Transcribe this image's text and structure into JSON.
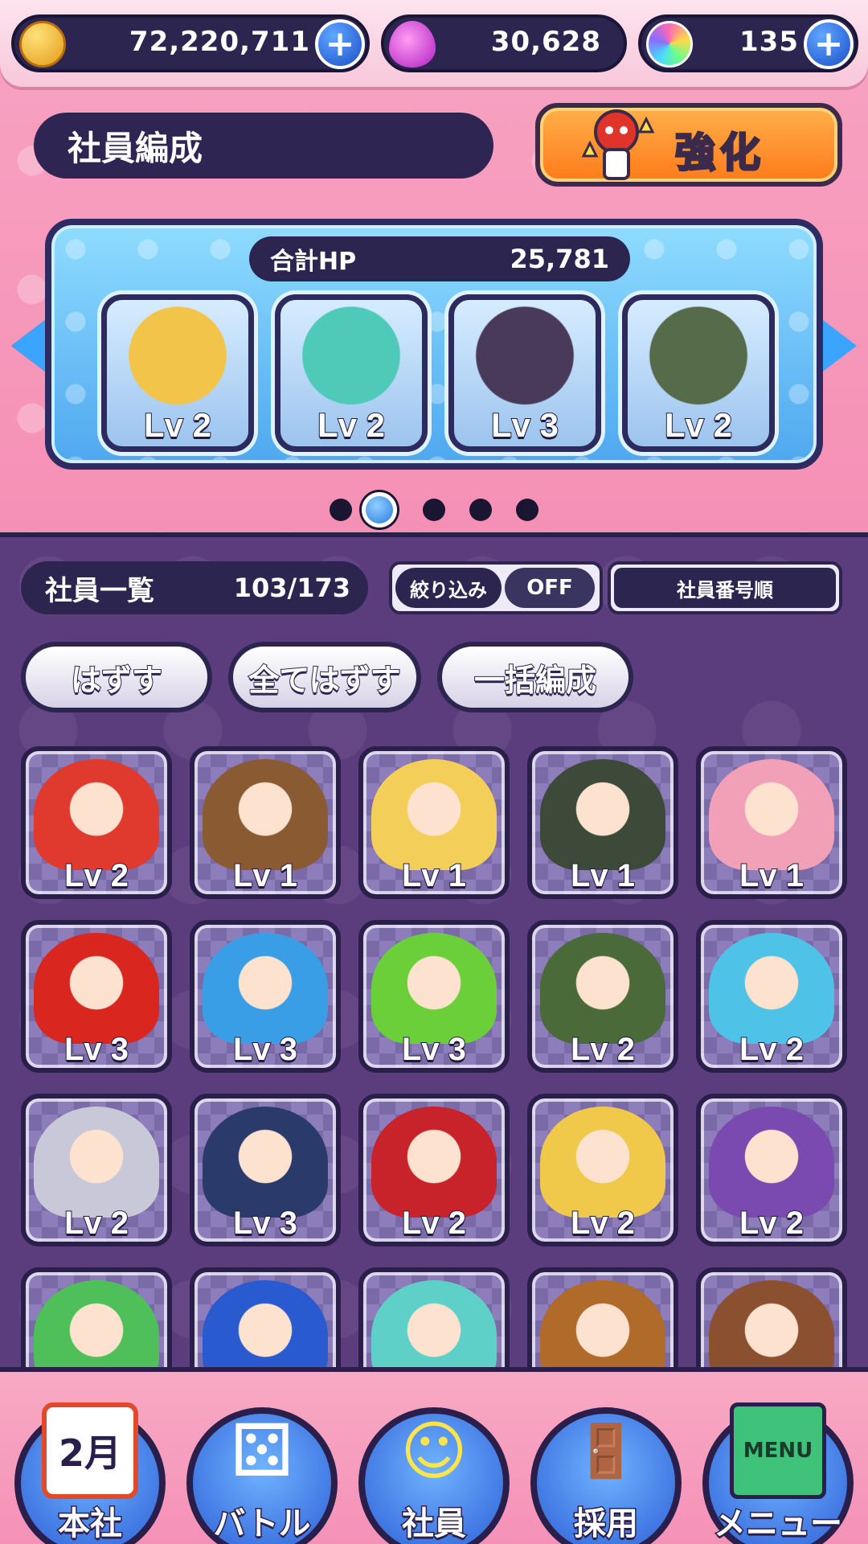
{
  "currencies": [
    {
      "icon": "gold-coin-icon",
      "value": "72,220,711",
      "has_plus": true
    },
    {
      "icon": "pink-drop-icon",
      "value": "30,628",
      "has_plus": false
    },
    {
      "icon": "rainbow-orb-icon",
      "value": "135",
      "has_plus": true
    }
  ],
  "plus_symbol": "+",
  "header": {
    "title": "社員編成",
    "enhance_label": "強化"
  },
  "team": {
    "hp_label": "合計HP",
    "hp_value": "25,781",
    "members": [
      {
        "level": "Lv 2",
        "color": "#f3c44a"
      },
      {
        "level": "Lv 2",
        "color": "#4fc9b8"
      },
      {
        "level": "Lv 3",
        "color": "#4a3a5a"
      },
      {
        "level": "Lv 2",
        "color": "#556b4a"
      }
    ],
    "pages": 5,
    "active_page": 1
  },
  "staff_list": {
    "title": "社員一覧",
    "count": "103/173",
    "filter_label": "絞り込み",
    "filter_value": "OFF",
    "sort_label": "社員番号順",
    "buttons": [
      "はずす",
      "全てはずす",
      "一括編成"
    ],
    "items": [
      {
        "level": "Lv 2",
        "color": "#e03a2e"
      },
      {
        "level": "Lv 1",
        "color": "#8a5a32"
      },
      {
        "level": "Lv 1",
        "color": "#f3cf5a"
      },
      {
        "level": "Lv 1",
        "color": "#3d4a3a"
      },
      {
        "level": "Lv 1",
        "color": "#f1a0b8"
      },
      {
        "level": "Lv 3",
        "color": "#d9261e"
      },
      {
        "level": "Lv 3",
        "color": "#3a9ee6"
      },
      {
        "level": "Lv 3",
        "color": "#6bcf3a"
      },
      {
        "level": "Lv 2",
        "color": "#4a6a3a"
      },
      {
        "level": "Lv 2",
        "color": "#4fc2e8"
      },
      {
        "level": "Lv 2",
        "color": "#c8c8d8"
      },
      {
        "level": "Lv 3",
        "color": "#2a3a6a"
      },
      {
        "level": "Lv 2",
        "color": "#c8222a"
      },
      {
        "level": "Lv 2",
        "color": "#f0c84a"
      },
      {
        "level": "Lv 2",
        "color": "#7a4ab0"
      },
      {
        "level": "",
        "color": "#4fbf5a"
      },
      {
        "level": "",
        "color": "#2a5ad0"
      },
      {
        "level": "",
        "color": "#5fd0c8"
      },
      {
        "level": "",
        "color": "#b06a2a"
      },
      {
        "level": "",
        "color": "#8a5030"
      }
    ]
  },
  "nav": [
    {
      "label": "本社",
      "icon": "calendar-icon",
      "glyph": "2月"
    },
    {
      "label": "バトル",
      "icon": "dice-icon",
      "glyph": "⚄"
    },
    {
      "label": "社員",
      "icon": "id-card-icon",
      "glyph": "☺"
    },
    {
      "label": "採用",
      "icon": "door-icon",
      "glyph": "🚪"
    },
    {
      "label": "メニュー",
      "icon": "menu-book-icon",
      "glyph": "MENU"
    }
  ]
}
